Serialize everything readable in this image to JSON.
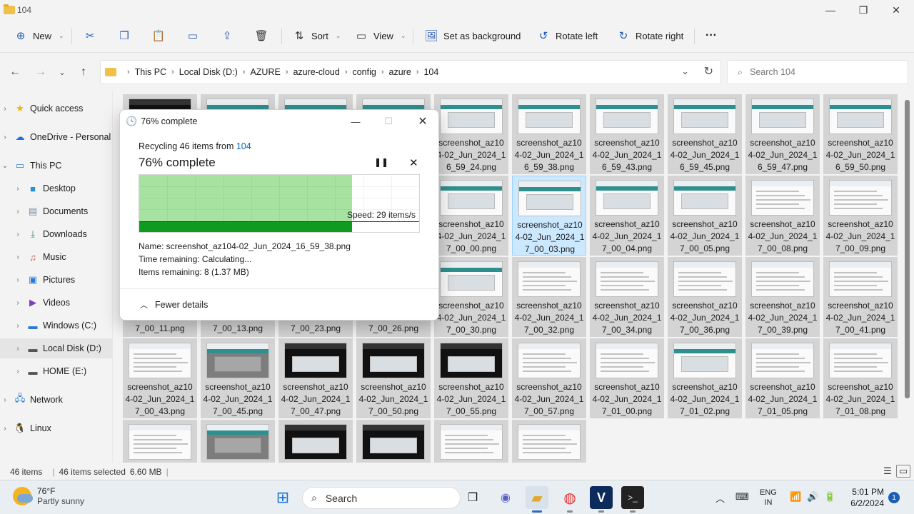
{
  "window": {
    "title": "104"
  },
  "toolbar": {
    "new_label": "New",
    "sort_label": "Sort",
    "view_label": "View",
    "set_bg_label": "Set as background",
    "rotate_left_label": "Rotate left",
    "rotate_right_label": "Rotate right",
    "more_label": "···"
  },
  "address": {
    "crumbs": [
      "This PC",
      "Local Disk (D:)",
      "AZURE",
      "azure-cloud",
      "config",
      "azure",
      "104"
    ],
    "search_placeholder": "Search 104"
  },
  "sidebar": {
    "items": [
      {
        "label": "Quick access",
        "icon": "star-icon"
      },
      {
        "label": "OneDrive - Personal",
        "icon": "cloud-icon"
      },
      {
        "label": "This PC",
        "icon": "monitor-icon"
      },
      {
        "label": "Desktop",
        "icon": "desktop-icon"
      },
      {
        "label": "Documents",
        "icon": "document-icon"
      },
      {
        "label": "Downloads",
        "icon": "download-icon"
      },
      {
        "label": "Music",
        "icon": "music-icon"
      },
      {
        "label": "Pictures",
        "icon": "pictures-icon"
      },
      {
        "label": "Videos",
        "icon": "video-icon"
      },
      {
        "label": "Windows (C:)",
        "icon": "drive-icon"
      },
      {
        "label": "Local Disk (D:)",
        "icon": "drive-icon"
      },
      {
        "label": "HOME (E:)",
        "icon": "drive-icon"
      },
      {
        "label": "Network",
        "icon": "network-icon"
      },
      {
        "label": "Linux",
        "icon": "linux-icon"
      }
    ]
  },
  "files": {
    "row1": [
      {
        "name": ""
      },
      {
        "name": ""
      },
      {
        "name": ""
      },
      {
        "name": ""
      },
      {
        "name": [
          "screenshot_az10",
          "4-02_Jun_2024_1",
          "6_59_24.png"
        ]
      },
      {
        "name": [
          "screenshot_az10",
          "4-02_Jun_2024_1",
          "6_59_38.png"
        ]
      },
      {
        "name": [
          "screenshot_az10",
          "4-02_Jun_2024_1",
          "6_59_43.png"
        ]
      },
      {
        "name": [
          "screenshot_az10",
          "4-02_Jun_2024_1",
          "6_59_45.png"
        ]
      },
      {
        "name": [
          "screenshot_az10",
          "4-02_Jun_2024_1",
          "6_59_47.png"
        ]
      },
      {
        "name": [
          "screenshot_az10",
          "4-02_Jun_2024_1",
          "6_59_50.png"
        ]
      }
    ],
    "row2": [
      {
        "name": [
          "screenshot_az10",
          "4-02_Jun_2024_1",
          "7_00_00.png"
        ]
      },
      {
        "name": [
          "screenshot_az10",
          "4-02_Jun_2024_1",
          "7_00_03.png"
        ]
      },
      {
        "name": [
          "screenshot_az10",
          "4-02_Jun_2024_1",
          "7_00_04.png"
        ]
      },
      {
        "name": [
          "screenshot_az10",
          "4-02_Jun_2024_1",
          "7_00_05.png"
        ]
      },
      {
        "name": [
          "screenshot_az10",
          "4-02_Jun_2024_1",
          "7_00_08.png"
        ]
      },
      {
        "name": [
          "screenshot_az10",
          "4-02_Jun_2024_1",
          "7_00_09.png"
        ]
      }
    ],
    "row3": [
      {
        "name": [
          "7_00_11.png"
        ]
      },
      {
        "name": [
          "7_00_13.png"
        ]
      },
      {
        "name": [
          "7_00_23.png"
        ]
      },
      {
        "name": [
          "7_00_26.png"
        ]
      },
      {
        "name": [
          "screenshot_az10",
          "4-02_Jun_2024_1",
          "7_00_30.png"
        ]
      },
      {
        "name": [
          "screenshot_az10",
          "4-02_Jun_2024_1",
          "7_00_32.png"
        ]
      },
      {
        "name": [
          "screenshot_az10",
          "4-02_Jun_2024_1",
          "7_00_34.png"
        ]
      },
      {
        "name": [
          "screenshot_az10",
          "4-02_Jun_2024_1",
          "7_00_36.png"
        ]
      },
      {
        "name": [
          "screenshot_az10",
          "4-02_Jun_2024_1",
          "7_00_39.png"
        ]
      },
      {
        "name": [
          "screenshot_az10",
          "4-02_Jun_2024_1",
          "7_00_41.png"
        ]
      }
    ],
    "row4": [
      {
        "name": [
          "screenshot_az10",
          "4-02_Jun_2024_1",
          "7_00_43.png"
        ]
      },
      {
        "name": [
          "screenshot_az10",
          "4-02_Jun_2024_1",
          "7_00_45.png"
        ]
      },
      {
        "name": [
          "screenshot_az10",
          "4-02_Jun_2024_1",
          "7_00_47.png"
        ]
      },
      {
        "name": [
          "screenshot_az10",
          "4-02_Jun_2024_1",
          "7_00_50.png"
        ]
      },
      {
        "name": [
          "screenshot_az10",
          "4-02_Jun_2024_1",
          "7_00_55.png"
        ]
      },
      {
        "name": [
          "screenshot_az10",
          "4-02_Jun_2024_1",
          "7_00_57.png"
        ]
      },
      {
        "name": [
          "screenshot_az10",
          "4-02_Jun_2024_1",
          "7_01_00.png"
        ]
      },
      {
        "name": [
          "screenshot_az10",
          "4-02_Jun_2024_1",
          "7_01_02.png"
        ]
      },
      {
        "name": [
          "screenshot_az10",
          "4-02_Jun_2024_1",
          "7_01_05.png"
        ]
      },
      {
        "name": [
          "screenshot_az10",
          "4-02_Jun_2024_1",
          "7_01_08.png"
        ]
      }
    ]
  },
  "status": {
    "count": "46 items",
    "selected": "46 items selected",
    "size": "6.60 MB"
  },
  "dialog": {
    "title": "76% complete",
    "from_prefix": "Recycling 46 items from",
    "from_link": "104",
    "percent_text": "76% complete",
    "progress": 0.76,
    "speed": "Speed: 29 items/s",
    "name_line": "Name: screenshot_az104-02_Jun_2024_16_59_38.png",
    "time_line": "Time remaining: Calculating...",
    "items_line": "Items remaining: 8 (1.37 MB)",
    "details_label": "Fewer details"
  },
  "taskbar": {
    "temp": "76°F",
    "condition": "Partly sunny",
    "search_label": "Search",
    "lang1": "ENG",
    "lang2": "IN",
    "time": "5:01 PM",
    "date": "6/2/2024",
    "notifications": "1"
  },
  "colors": {
    "accent": "#0067c0",
    "progress_fill": "#a7e3a0",
    "progress_bar": "#0f9b1f",
    "selection": "#cce8ff"
  }
}
